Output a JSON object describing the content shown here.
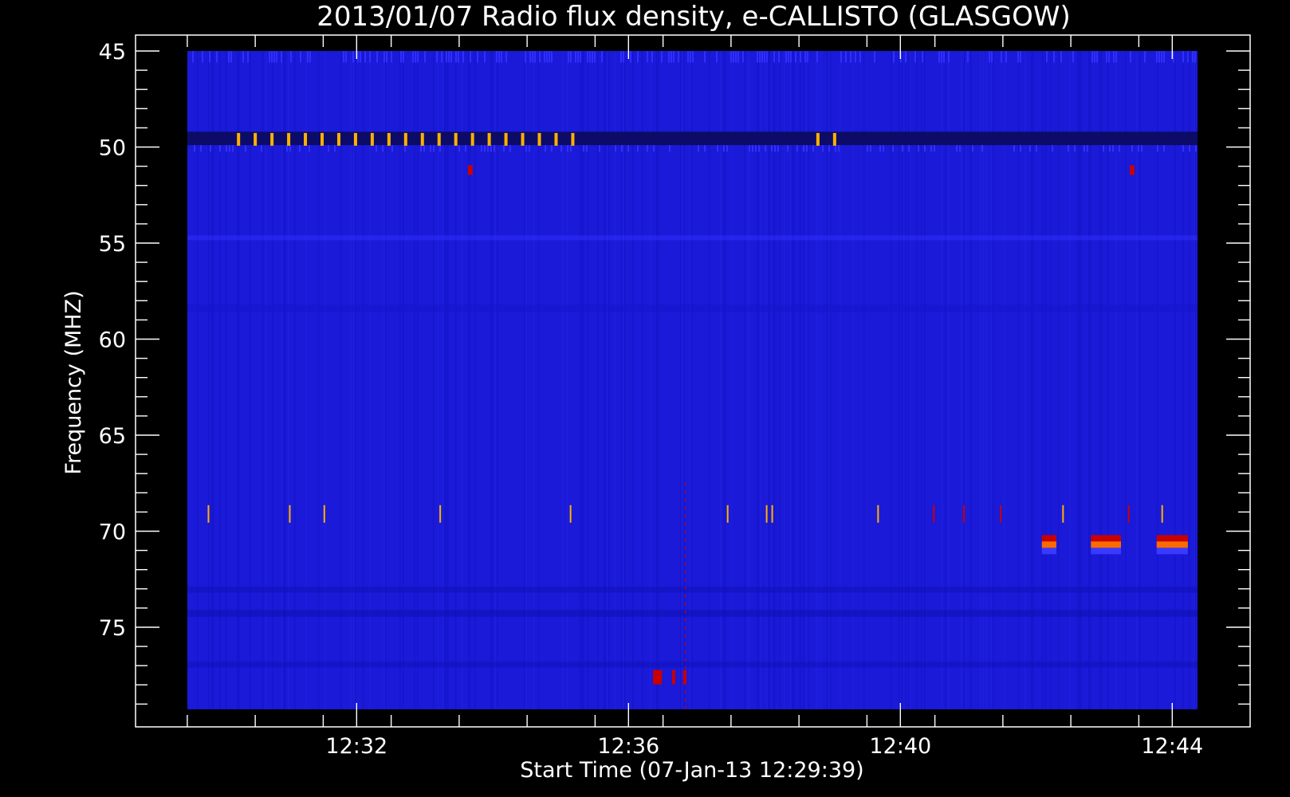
{
  "chart_data": {
    "type": "heatmap",
    "title": "2013/01/07  Radio flux density, e-CALLISTO (GLASGOW)",
    "xlabel": "Start Time (07-Jan-13 12:29:39)",
    "ylabel": "Frequency (MHZ)",
    "x_tick_labels": [
      "12:32",
      "12:36",
      "12:40",
      "12:44"
    ],
    "x_tick_minutes": [
      152,
      396,
      640,
      884
    ],
    "xlim_minutes": [
      0,
      900
    ],
    "y_ticks": [
      45,
      50,
      55,
      60,
      65,
      70,
      75
    ],
    "y_tick_labels": [
      "45",
      "50",
      "55",
      "60",
      "65",
      "70",
      "75"
    ],
    "ylim": [
      45,
      79.3
    ],
    "y_inverted": true,
    "grid": false,
    "colors": {
      "background": "#000000",
      "axis": "#ffffff",
      "base": "#1a1ad8",
      "dark_band": "#0a0a55",
      "hot": "#ff6a00",
      "red": "#c80000",
      "yellow": "#ffb000",
      "speck": "#2f2fff"
    },
    "features": [
      {
        "kind": "periodic_pulses",
        "freq_mhz": 49.6,
        "minutes": [
          46,
          61,
          76,
          91,
          106,
          121,
          136,
          151,
          166,
          181,
          196,
          211,
          226,
          241,
          256,
          271,
          286,
          301,
          316,
          331,
          346
        ],
        "color": "yellow"
      },
      {
        "kind": "periodic_pulses",
        "freq_mhz": 49.6,
        "minutes": [
          566,
          581
        ],
        "color": "yellow"
      },
      {
        "kind": "dark_band",
        "freq_range": [
          49.2,
          49.9
        ]
      },
      {
        "kind": "spot",
        "freq_mhz": 51.2,
        "minutes": [
          254,
          848
        ],
        "color": "red"
      },
      {
        "kind": "line_spikes",
        "freq_mhz": 69.1,
        "minutes": [
          19,
          92,
          123,
          227,
          344,
          485,
          520,
          525,
          620,
          786,
          875
        ],
        "color": "yellow"
      },
      {
        "kind": "line_spikes",
        "freq_mhz": 69.1,
        "minutes": [
          670,
          697,
          730,
          845
        ],
        "color": "red"
      },
      {
        "kind": "burst_blocks",
        "freq_mhz": 70.7,
        "blocks": [
          [
            767,
            780
          ],
          [
            811,
            838
          ],
          [
            870,
            898
          ]
        ],
        "color": "hot"
      },
      {
        "kind": "burst_blocks",
        "freq_mhz": 77.6,
        "blocks": [
          [
            418,
            426
          ],
          [
            435,
            438
          ],
          [
            445,
            448
          ]
        ],
        "color": "red"
      },
      {
        "kind": "vertical_line",
        "minute": 447,
        "freq_range": [
          67.5,
          79.3
        ],
        "color": "red"
      }
    ]
  }
}
